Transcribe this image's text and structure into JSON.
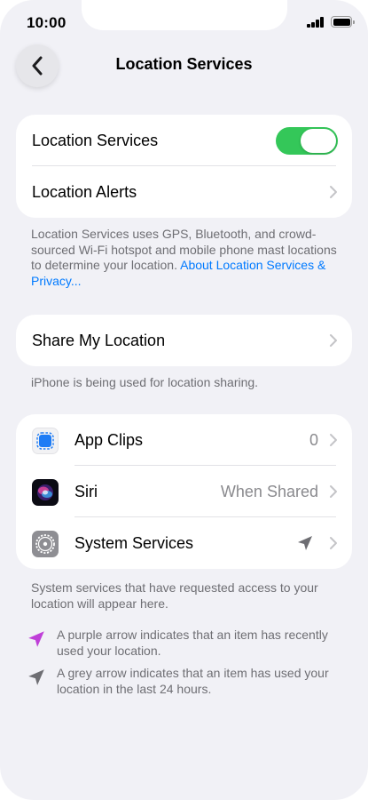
{
  "status_bar": {
    "time": "10:00"
  },
  "nav": {
    "title": "Location Services"
  },
  "main_card": {
    "location_services_label": "Location Services",
    "location_services_enabled": true,
    "location_alerts_label": "Location Alerts"
  },
  "main_footnote": {
    "text": "Location Services uses GPS, Bluetooth, and crowd-sourced Wi-Fi hotspot and mobile phone mast locations to determine your location. ",
    "link": "About Location Services & Privacy..."
  },
  "share_card": {
    "label": "Share My Location"
  },
  "share_footnote": "iPhone is being used for location sharing.",
  "apps": [
    {
      "label": "App Clips",
      "value": "0",
      "icon": "app-clips-icon"
    },
    {
      "label": "Siri",
      "value": "When Shared",
      "icon": "siri-icon"
    },
    {
      "label": "System Services",
      "value": "",
      "icon": "settings-gear-icon"
    }
  ],
  "apps_footnote": "System services that have requested access to your location will appear here.",
  "legend": [
    {
      "text": "A purple arrow indicates that an item has recently used your location.",
      "icon": "purple-location-arrow-icon",
      "color": "#bf3fd8"
    },
    {
      "text": "A grey arrow indicates that an item has used your location in the last 24 hours.",
      "icon": "grey-location-arrow-icon",
      "color": "#8a8a8e"
    }
  ],
  "colors": {
    "toggle_on": "#34c759",
    "link": "#007aff",
    "background": "#f1f1f6"
  }
}
